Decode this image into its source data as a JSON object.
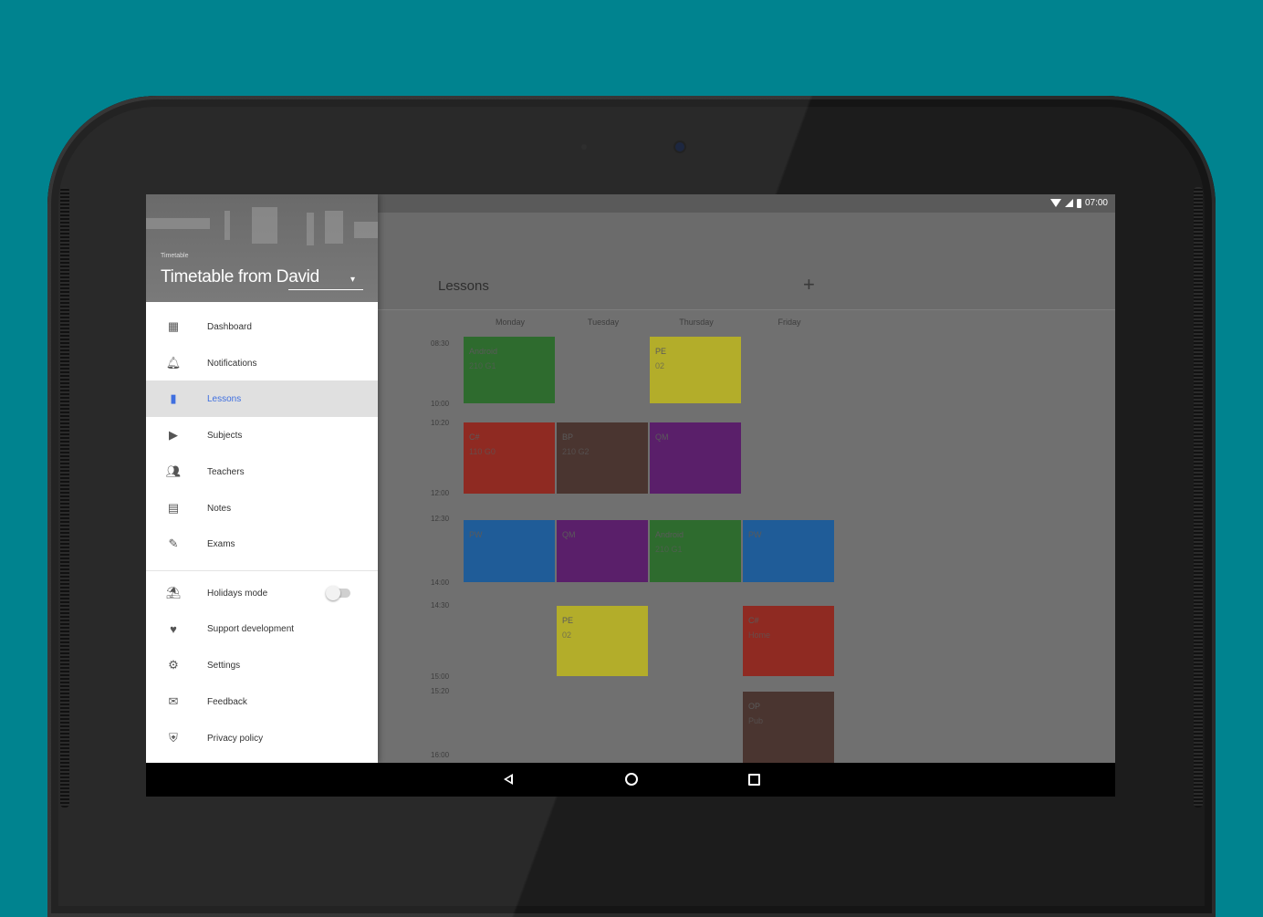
{
  "status_bar": {
    "time": "07:00"
  },
  "drawer": {
    "header_subtitle": "Timetable",
    "header_title": "Timetable from David",
    "items": [
      {
        "label": "Dashboard",
        "icon": "dashboard-icon"
      },
      {
        "label": "Notifications",
        "icon": "bell-icon"
      },
      {
        "label": "Lessons",
        "icon": "book-icon",
        "active": true
      },
      {
        "label": "Subjects",
        "icon": "label-icon"
      },
      {
        "label": "Teachers",
        "icon": "people-icon"
      },
      {
        "label": "Notes",
        "icon": "note-icon"
      },
      {
        "label": "Exams",
        "icon": "pen-icon"
      }
    ],
    "secondary_items": [
      {
        "label": "Holidays mode",
        "icon": "beach-icon",
        "toggle": false
      },
      {
        "label": "Support development",
        "icon": "heart-icon"
      },
      {
        "label": "Settings",
        "icon": "gear-icon"
      },
      {
        "label": "Feedback",
        "icon": "mail-icon"
      },
      {
        "label": "Privacy policy",
        "icon": "shield-icon"
      }
    ]
  },
  "appbar": {
    "title": "Lessons",
    "add_icon": "plus-icon"
  },
  "days": [
    "Monday",
    "Tuesday",
    "Thursday",
    "Friday"
  ],
  "times": [
    "08:30",
    "10:00",
    "10:20",
    "12:00",
    "12:30",
    "14:00",
    "14:30",
    "15:00",
    "15:20",
    "16:00"
  ],
  "lessons": [
    {
      "subject": "Android",
      "room": "210 G1",
      "color": "#2e6b2e"
    },
    {
      "subject": "PE",
      "room": "02",
      "color": "#b3ad2a"
    },
    {
      "subject": "C#",
      "room": "110 G0",
      "color": "#8f2a22"
    },
    {
      "subject": "BP",
      "room": "210 G2",
      "color": "#4a3530"
    },
    {
      "subject": "QM",
      "room": "",
      "color": "#5a1f6a"
    },
    {
      "subject": "PW",
      "room": "",
      "color": "#1f5c98"
    },
    {
      "subject": "QM",
      "room": "",
      "color": "#5a1f6a"
    },
    {
      "subject": "Android",
      "room": "210 G1",
      "color": "#2e6b2e"
    },
    {
      "subject": "PW",
      "room": "",
      "color": "#1f5c98"
    },
    {
      "subject": "PE",
      "room": "02",
      "color": "#b3ad2a"
    },
    {
      "subject": "C#",
      "room": "Home",
      "color": "#8f2a22"
    },
    {
      "subject": "OP",
      "room": "Pub",
      "color": "#4a3530"
    }
  ]
}
